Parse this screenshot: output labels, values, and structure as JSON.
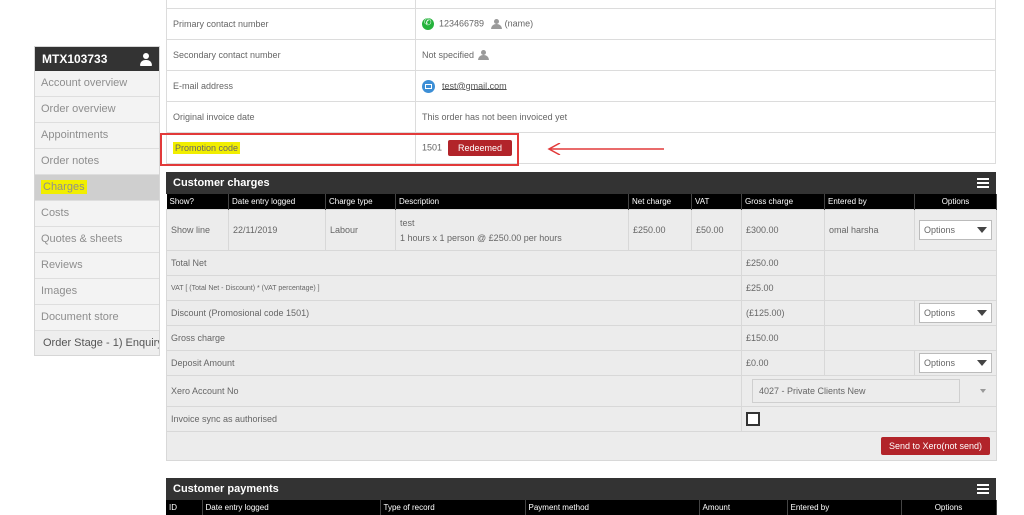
{
  "sidebar": {
    "order_id": "MTX103733",
    "items": [
      {
        "label": "Account overview"
      },
      {
        "label": "Order overview"
      },
      {
        "label": "Appointments"
      },
      {
        "label": "Order notes"
      },
      {
        "label": "Charges"
      },
      {
        "label": "Costs"
      },
      {
        "label": "Quotes & sheets"
      },
      {
        "label": "Reviews"
      },
      {
        "label": "Images"
      },
      {
        "label": "Document store"
      }
    ],
    "stage": "Order Stage - 1) Enquiry"
  },
  "contact": {
    "primary_label": "Primary contact number",
    "primary_number": "123466789",
    "primary_name": "(name)",
    "secondary_label": "Secondary contact number",
    "secondary_value": "Not specified",
    "email_label": "E-mail address",
    "email_value": "test@gmail.com",
    "invoice_label": "Original invoice date",
    "invoice_value": "This order has not been invoiced yet",
    "promo_label": "Promotion code",
    "promo_value": "1501",
    "promo_badge": "Redeemed"
  },
  "charges": {
    "title": "Customer charges",
    "columns": [
      "Show?",
      "Date entry logged",
      "Charge type",
      "Description",
      "Net charge",
      "VAT",
      "Gross charge",
      "Entered by",
      "Options"
    ],
    "row": {
      "show": "Show line",
      "date": "22/11/2019",
      "type": "Labour",
      "desc_title": "test",
      "desc_detail": "1 hours x 1 person @ £250.00 per hours",
      "net": "£250.00",
      "vat": "£50.00",
      "gross": "£300.00",
      "entered_by": "omal harsha",
      "options": "Options"
    },
    "total_net_label": "Total Net",
    "total_net_value": "£250.00",
    "vat_label": "VAT [ (Total Net - Discount) * (VAT percentage) ]",
    "vat_value": "£25.00",
    "discount_label": "Discount (Promosional code 1501)",
    "discount_value": "(£125.00)",
    "discount_options": "Options",
    "gross_label": "Gross charge",
    "gross_value": "£150.00",
    "deposit_label": "Deposit Amount",
    "deposit_value": "£0.00",
    "deposit_options": "Options",
    "xero_label": "Xero Account No",
    "xero_value": "4027 - Private Clients New",
    "sync_label": "Invoice sync as authorised",
    "send_button": "Send to Xero(not send)"
  },
  "payments": {
    "title": "Customer payments",
    "columns": [
      "ID",
      "Date entry logged",
      "Type of record",
      "Payment method",
      "Amount",
      "Entered by",
      "Options"
    ]
  },
  "colors": {
    "accent_red": "#b2242a",
    "header_dark": "#333333",
    "highlight": "#f1ee00"
  }
}
